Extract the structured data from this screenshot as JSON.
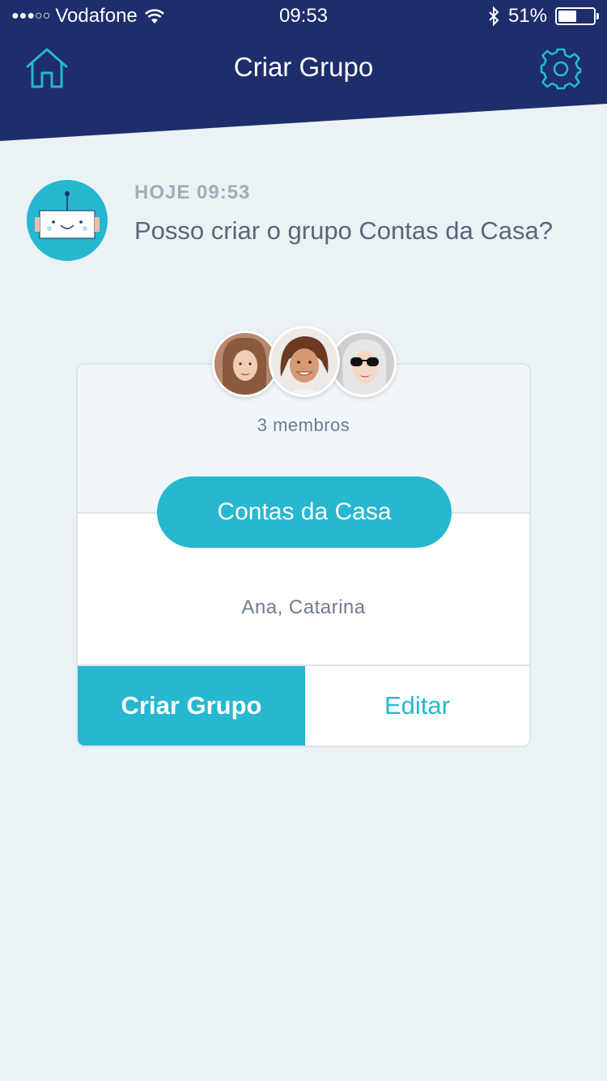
{
  "status_bar": {
    "signal": "●●●○○",
    "carrier": "Vodafone",
    "time": "09:53",
    "battery": "51%"
  },
  "nav": {
    "title": "Criar Grupo",
    "home_icon": "home-icon",
    "settings_icon": "gear-icon"
  },
  "message": {
    "timestamp": "HOJE 09:53",
    "text": "Posso criar o grupo Contas da Casa?"
  },
  "group_card": {
    "members_label": "3 membros",
    "group_name": "Contas da Casa",
    "member_names": "Ana, Catarina",
    "create_label": "Criar Grupo",
    "edit_label": "Editar"
  },
  "colors": {
    "header": "#1e2d6b",
    "accent": "#25b8d0",
    "background": "#ebf2f6"
  }
}
